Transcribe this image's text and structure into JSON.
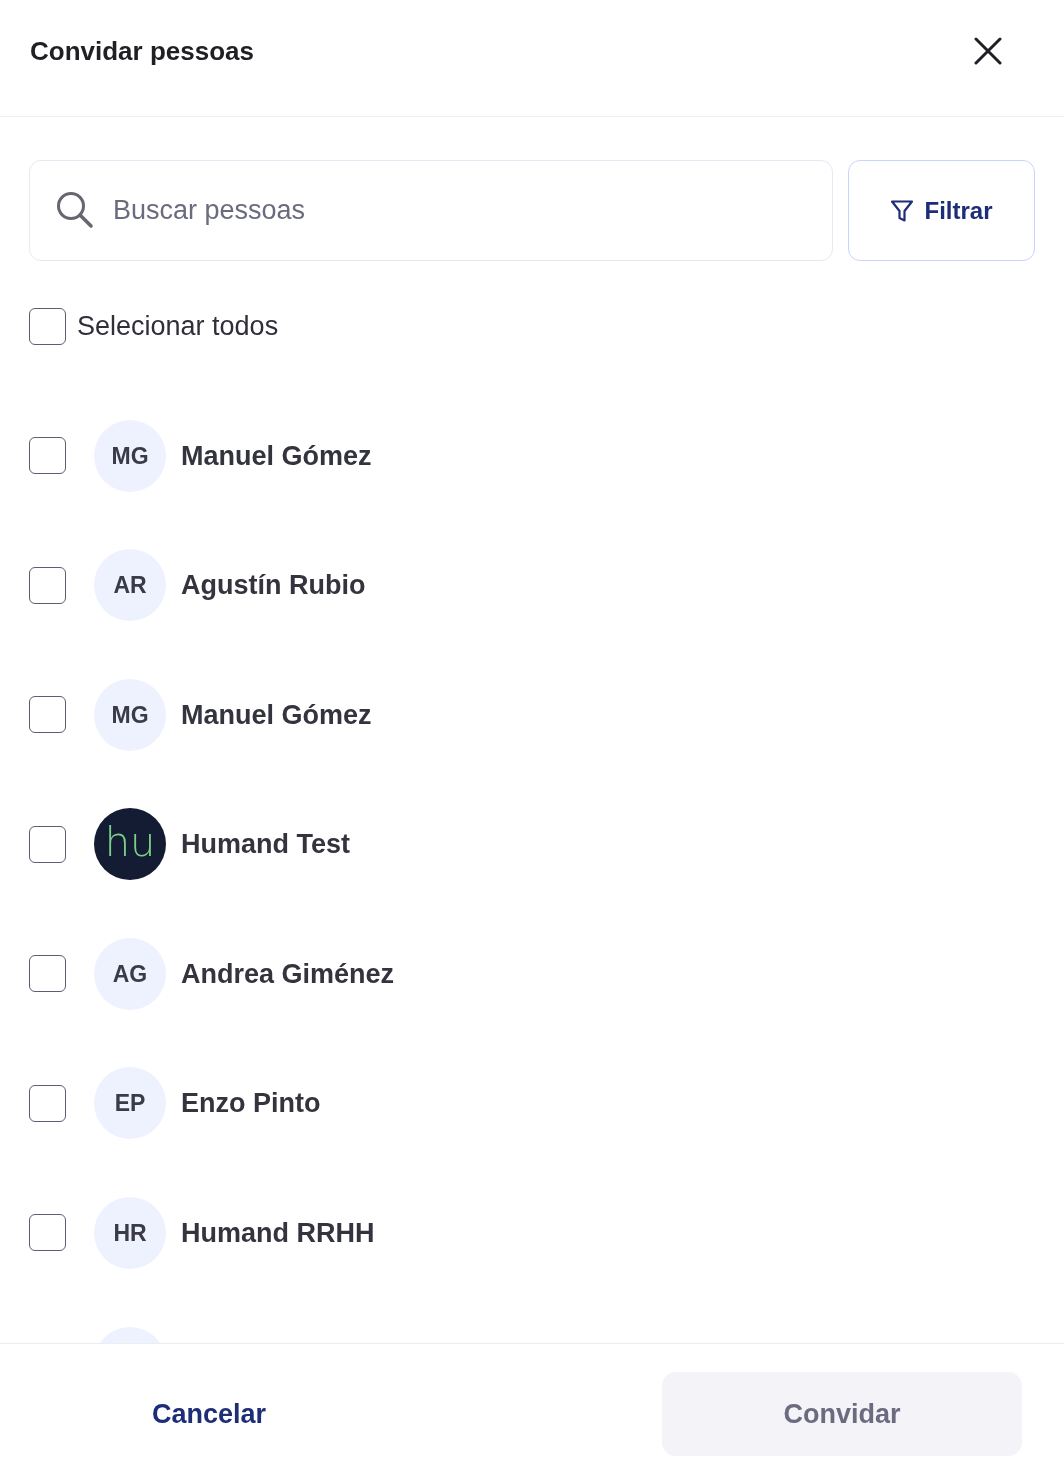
{
  "dialog": {
    "title": "Convidar pessoas"
  },
  "search": {
    "placeholder": "Buscar pessoas"
  },
  "filter_button": {
    "label": "Filtrar"
  },
  "select_all": {
    "label": "Selecionar todos",
    "checked": false
  },
  "people": [
    {
      "kind": "initials",
      "avatar": "MG",
      "name": "Manuel Gómez",
      "checked": false
    },
    {
      "kind": "initials",
      "avatar": "AR",
      "name": "Agustín Rubio",
      "checked": false
    },
    {
      "kind": "initials",
      "avatar": "MG",
      "name": "Manuel Gómez",
      "checked": false
    },
    {
      "kind": "logo",
      "avatar": "hu",
      "name": "Humand Test",
      "checked": false
    },
    {
      "kind": "initials",
      "avatar": "AG",
      "name": "Andrea Giménez",
      "checked": false
    },
    {
      "kind": "initials",
      "avatar": "EP",
      "name": "Enzo Pinto",
      "checked": false
    },
    {
      "kind": "initials",
      "avatar": "HR",
      "name": "Humand RRHH",
      "checked": false
    }
  ],
  "more_below": true,
  "footer": {
    "cancel": "Cancelar",
    "confirm": "Convidar",
    "confirm_disabled": true
  }
}
